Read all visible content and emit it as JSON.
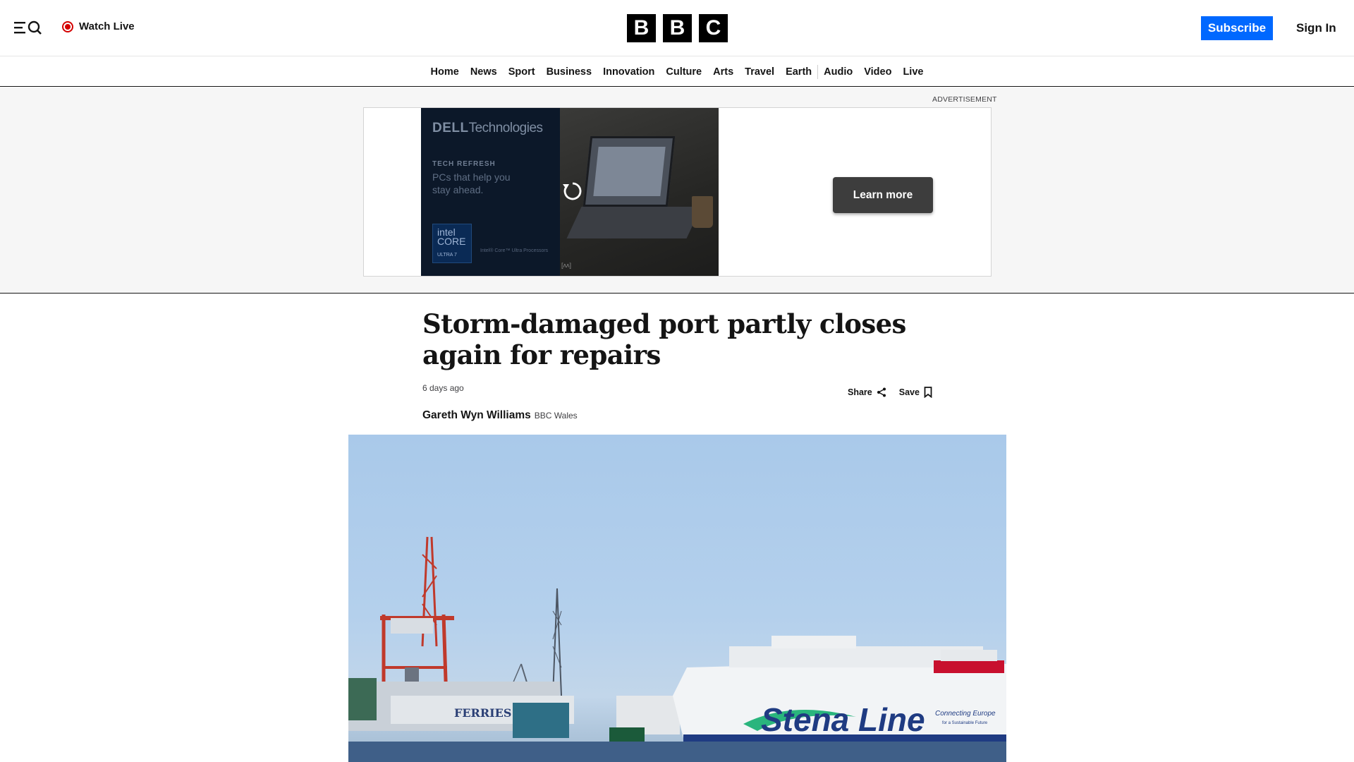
{
  "header": {
    "watch_live": "Watch Live",
    "logo_letters": [
      "B",
      "B",
      "C"
    ],
    "subscribe": "Subscribe",
    "sign_in": "Sign In"
  },
  "nav": {
    "items": [
      "Home",
      "News",
      "Sport",
      "Business",
      "Innovation",
      "Culture",
      "Arts",
      "Travel",
      "Earth",
      "Audio",
      "Video",
      "Live"
    ]
  },
  "ad": {
    "label": "ADVERTISEMENT",
    "brand_bold": "DELL",
    "brand_rest": "Technologies",
    "kicker": "TECH REFRESH",
    "tagline": "PCs that help you stay ahead.",
    "chip_line1": "intel",
    "chip_line2": "CORE",
    "chip_line3": "ULTRA 7",
    "chip_note": "Intel® Core™ Ultra Processors",
    "corner_tag": "[ʌʌ]",
    "cta": "Learn more"
  },
  "article": {
    "headline": "Storm-damaged port partly closes again for repairs",
    "timestamp": "6 days ago",
    "share": "Share",
    "save": "Save",
    "author": "Gareth Wyn Williams",
    "outlet": "BBC Wales"
  },
  "hero_image": {
    "ship_livery": "Stena Line",
    "ship_slogan": "Connecting Europe",
    "ship_slogan_sub": "for a Sustainable Future",
    "ferries_text": "FERRIES"
  },
  "colors": {
    "accent_blue": "#0068ff",
    "live_red": "#d40000",
    "text": "#141414"
  }
}
